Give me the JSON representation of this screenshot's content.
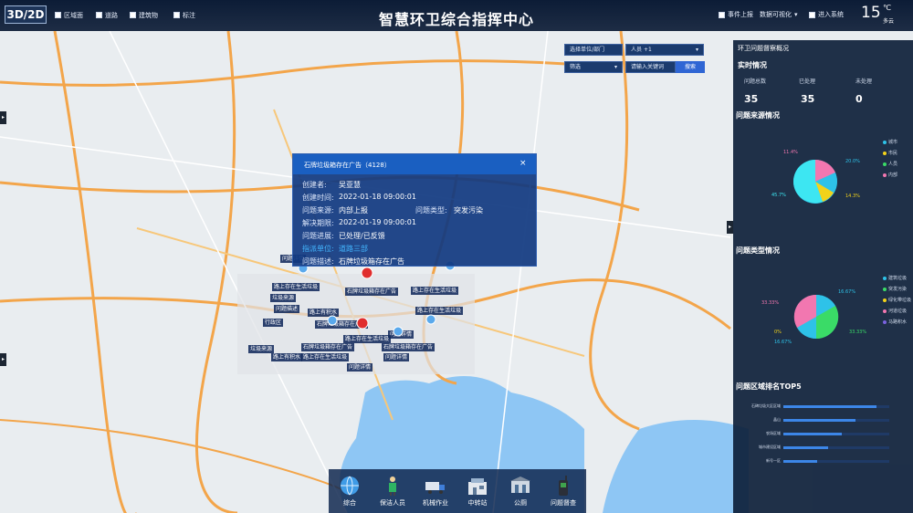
{
  "header": {
    "title": "智慧环卫综合指挥中心",
    "mode_toggle": "3D/2D",
    "layers": [
      "区域面",
      "道路",
      "建筑物",
      "标注"
    ],
    "right_items": [
      "事件上报",
      "数据可视化",
      "进入系统"
    ],
    "temperature": "15",
    "temp_unit": "℃",
    "weather": "多云"
  },
  "map": {
    "marker_labels": [
      "石牌垃圾箱存在广告",
      "路上存在生活垃圾",
      "问题描述",
      "行政区",
      "垃圾来源",
      "路上有积水",
      "问题详情"
    ]
  },
  "filters": {
    "unit_placeholder": "选择单位/部门",
    "person_label": "人员",
    "person_count": "+1",
    "screen_label": "筛选",
    "keyword_placeholder": "请输入关键词",
    "search_label": "搜索"
  },
  "right_panel": {
    "title": "环卫问题督察概况",
    "realtime": {
      "heading": "实时情况",
      "labels": [
        "问题总数",
        "已处理",
        "未处理"
      ],
      "values": [
        "35",
        "35",
        "0"
      ]
    },
    "source": {
      "heading": "问题来源情况",
      "legend": [
        "城市",
        "市民",
        "人员",
        "内部"
      ],
      "legend_colors": [
        "#2ec2e8",
        "#f2d21a",
        "#3adb67",
        "#f277b0"
      ],
      "percent_labels": [
        "11.4%",
        "20.0%",
        "14.3%",
        "45.7%"
      ]
    },
    "types": {
      "heading": "问题类型情况",
      "legend": [
        "建筑垃圾",
        "突发污染",
        "绿化带垃圾",
        "河道垃圾",
        "马路积水"
      ],
      "legend_colors": [
        "#2ec2e8",
        "#3adb67",
        "#f2d21a",
        "#f277b0",
        "#7a62e0"
      ],
      "percent_labels": [
        "33.33%",
        "16.67%",
        "0%",
        "16.67%",
        "33.33%"
      ]
    },
    "ranking": {
      "heading": "问题区域排名TOP5",
      "items": [
        {
          "label": "石碑垃圾大区区域",
          "value": 0.88
        },
        {
          "label": "晶山",
          "value": 0.68
        },
        {
          "label": "农场区域",
          "value": 0.55
        },
        {
          "label": "城市建设区域",
          "value": 0.42
        },
        {
          "label": "新号一区",
          "value": 0.32
        }
      ]
    }
  },
  "popup": {
    "title": "石牌垃圾箱存在广告（4128）",
    "close": "×",
    "fields": [
      {
        "k": "创建者:",
        "v": "吴亚慧"
      },
      {
        "k": "创建时间:",
        "v": "2022-01-18 09:00:01"
      },
      {
        "k": "问题来源:",
        "v": "内部上报"
      },
      {
        "k": "问题类型:",
        "v": "突发污染"
      },
      {
        "k": "解决期限:",
        "v": "2022-01-19 09:00:01"
      },
      {
        "k": "问题进展:",
        "v": "已处理/已反馈"
      },
      {
        "k": "指派单位:",
        "v": "道路三部"
      },
      {
        "k": "问题描述:",
        "v": "石牌垃圾箱存在广告"
      }
    ]
  },
  "bottom_nav": [
    "综合",
    "保洁人员",
    "机械作业",
    "中转站",
    "公厕",
    "问题督查"
  ],
  "colors": {
    "accent": "#2f66d4",
    "panel": "#0d1f3a",
    "header": "#0c1c36"
  }
}
